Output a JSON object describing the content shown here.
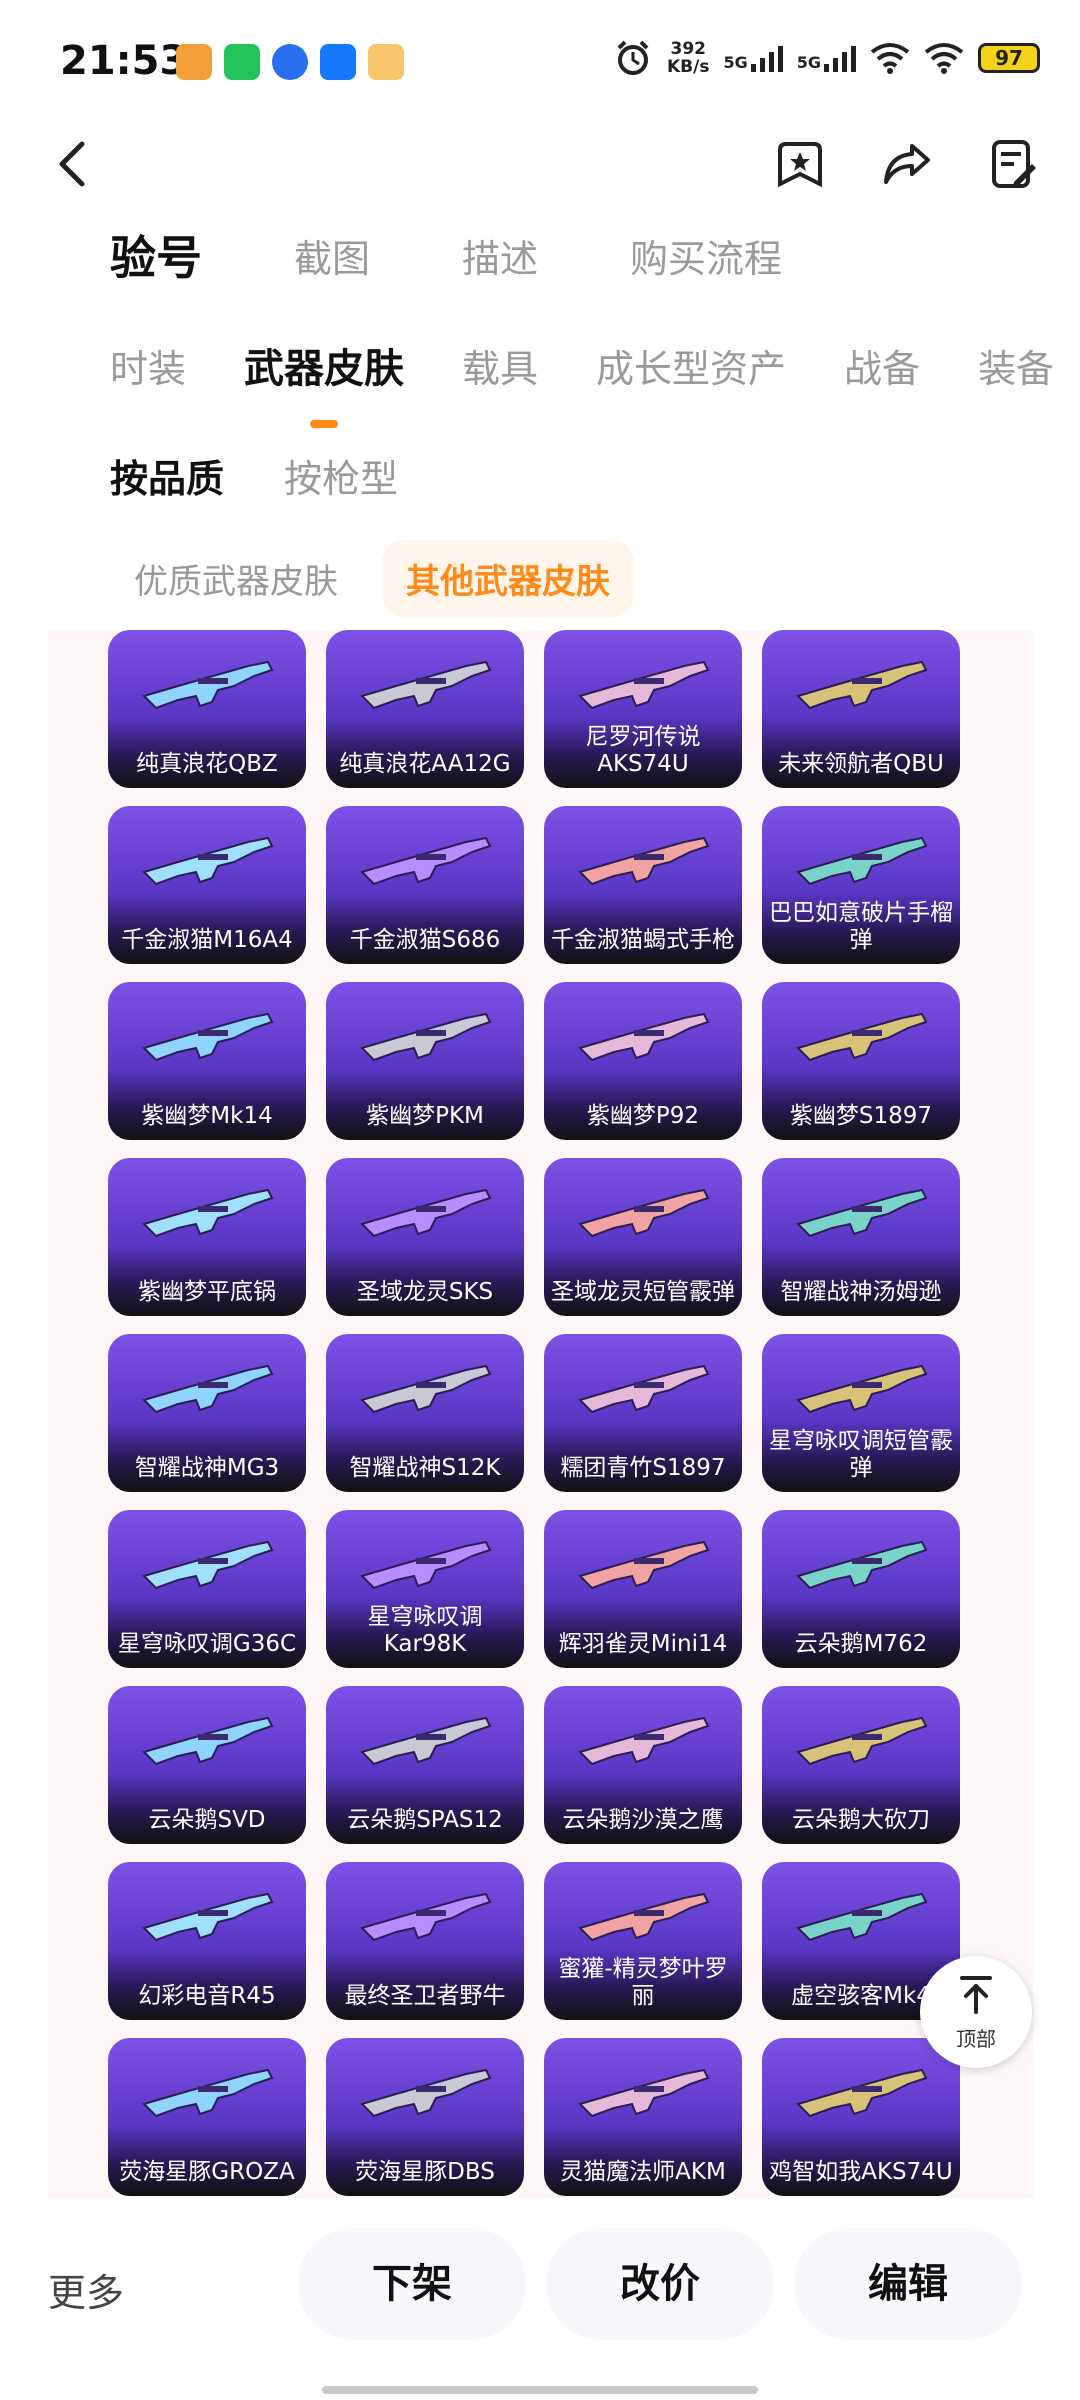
{
  "status": {
    "time": "21:53",
    "speed_value": "392",
    "speed_unit": "KB/s",
    "signal1": "5G",
    "signal2": "5G",
    "battery": "97"
  },
  "tabs_level1": [
    "验号",
    "截图",
    "描述",
    "购买流程"
  ],
  "tabs_level2": [
    "时装",
    "武器皮肤",
    "载具",
    "成长型资产",
    "战备",
    "装备"
  ],
  "tabs_level3": [
    "按品质",
    "按枪型"
  ],
  "chips": [
    "优质武器皮肤",
    "其他武器皮肤"
  ],
  "cards": [
    "纯真浪花QBZ",
    "纯真浪花AA12G",
    "尼罗河传说AKS74U",
    "未来领航者QBU",
    "千金淑猫M16A4",
    "千金淑猫S686",
    "千金淑猫蝎式手枪",
    "巴巴如意破片手榴弹",
    "紫幽梦Mk14",
    "紫幽梦PKM",
    "紫幽梦P92",
    "紫幽梦S1897",
    "紫幽梦平底锅",
    "圣域龙灵SKS",
    "圣域龙灵短管霰弹",
    "智耀战神汤姆逊",
    "智耀战神MG3",
    "智耀战神S12K",
    "糯团青竹S1897",
    "星穹咏叹调短管霰弹",
    "星穹咏叹调G36C",
    "星穹咏叹调Kar98K",
    "辉羽雀灵Mini14",
    "云朵鹅M762",
    "云朵鹅SVD",
    "云朵鹅SPAS12",
    "云朵鹅沙漠之鹰",
    "云朵鹅大砍刀",
    "幻彩电音R45",
    "最终圣卫者野牛",
    "蜜獾-精灵梦叶罗丽",
    "虚空骇客Mk4",
    "荧海星豚GROZA",
    "荧海星豚DBS",
    "灵猫魔法师AKM",
    "鸡智如我AKS74U"
  ],
  "top_button": "顶部",
  "bottom": {
    "more": "更多",
    "delist": "下架",
    "reprice": "改价",
    "edit": "编辑"
  }
}
